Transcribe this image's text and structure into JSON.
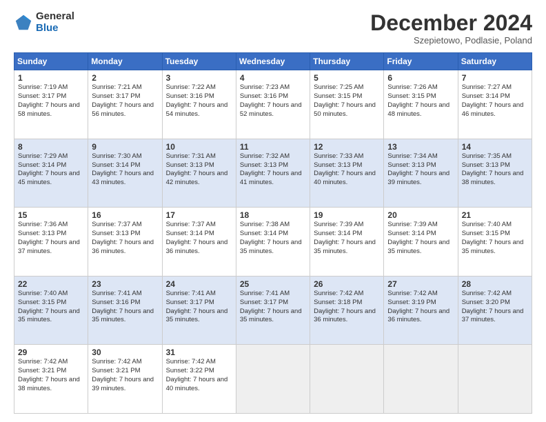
{
  "logo": {
    "general": "General",
    "blue": "Blue"
  },
  "title": "December 2024",
  "subtitle": "Szepietowo, Podlasie, Poland",
  "days_of_week": [
    "Sunday",
    "Monday",
    "Tuesday",
    "Wednesday",
    "Thursday",
    "Friday",
    "Saturday"
  ],
  "weeks": [
    [
      {
        "day": "1",
        "sunrise": "Sunrise: 7:19 AM",
        "sunset": "Sunset: 3:17 PM",
        "daylight": "Daylight: 7 hours and 58 minutes."
      },
      {
        "day": "2",
        "sunrise": "Sunrise: 7:21 AM",
        "sunset": "Sunset: 3:17 PM",
        "daylight": "Daylight: 7 hours and 56 minutes."
      },
      {
        "day": "3",
        "sunrise": "Sunrise: 7:22 AM",
        "sunset": "Sunset: 3:16 PM",
        "daylight": "Daylight: 7 hours and 54 minutes."
      },
      {
        "day": "4",
        "sunrise": "Sunrise: 7:23 AM",
        "sunset": "Sunset: 3:16 PM",
        "daylight": "Daylight: 7 hours and 52 minutes."
      },
      {
        "day": "5",
        "sunrise": "Sunrise: 7:25 AM",
        "sunset": "Sunset: 3:15 PM",
        "daylight": "Daylight: 7 hours and 50 minutes."
      },
      {
        "day": "6",
        "sunrise": "Sunrise: 7:26 AM",
        "sunset": "Sunset: 3:15 PM",
        "daylight": "Daylight: 7 hours and 48 minutes."
      },
      {
        "day": "7",
        "sunrise": "Sunrise: 7:27 AM",
        "sunset": "Sunset: 3:14 PM",
        "daylight": "Daylight: 7 hours and 46 minutes."
      }
    ],
    [
      {
        "day": "8",
        "sunrise": "Sunrise: 7:29 AM",
        "sunset": "Sunset: 3:14 PM",
        "daylight": "Daylight: 7 hours and 45 minutes."
      },
      {
        "day": "9",
        "sunrise": "Sunrise: 7:30 AM",
        "sunset": "Sunset: 3:14 PM",
        "daylight": "Daylight: 7 hours and 43 minutes."
      },
      {
        "day": "10",
        "sunrise": "Sunrise: 7:31 AM",
        "sunset": "Sunset: 3:13 PM",
        "daylight": "Daylight: 7 hours and 42 minutes."
      },
      {
        "day": "11",
        "sunrise": "Sunrise: 7:32 AM",
        "sunset": "Sunset: 3:13 PM",
        "daylight": "Daylight: 7 hours and 41 minutes."
      },
      {
        "day": "12",
        "sunrise": "Sunrise: 7:33 AM",
        "sunset": "Sunset: 3:13 PM",
        "daylight": "Daylight: 7 hours and 40 minutes."
      },
      {
        "day": "13",
        "sunrise": "Sunrise: 7:34 AM",
        "sunset": "Sunset: 3:13 PM",
        "daylight": "Daylight: 7 hours and 39 minutes."
      },
      {
        "day": "14",
        "sunrise": "Sunrise: 7:35 AM",
        "sunset": "Sunset: 3:13 PM",
        "daylight": "Daylight: 7 hours and 38 minutes."
      }
    ],
    [
      {
        "day": "15",
        "sunrise": "Sunrise: 7:36 AM",
        "sunset": "Sunset: 3:13 PM",
        "daylight": "Daylight: 7 hours and 37 minutes."
      },
      {
        "day": "16",
        "sunrise": "Sunrise: 7:37 AM",
        "sunset": "Sunset: 3:13 PM",
        "daylight": "Daylight: 7 hours and 36 minutes."
      },
      {
        "day": "17",
        "sunrise": "Sunrise: 7:37 AM",
        "sunset": "Sunset: 3:14 PM",
        "daylight": "Daylight: 7 hours and 36 minutes."
      },
      {
        "day": "18",
        "sunrise": "Sunrise: 7:38 AM",
        "sunset": "Sunset: 3:14 PM",
        "daylight": "Daylight: 7 hours and 35 minutes."
      },
      {
        "day": "19",
        "sunrise": "Sunrise: 7:39 AM",
        "sunset": "Sunset: 3:14 PM",
        "daylight": "Daylight: 7 hours and 35 minutes."
      },
      {
        "day": "20",
        "sunrise": "Sunrise: 7:39 AM",
        "sunset": "Sunset: 3:14 PM",
        "daylight": "Daylight: 7 hours and 35 minutes."
      },
      {
        "day": "21",
        "sunrise": "Sunrise: 7:40 AM",
        "sunset": "Sunset: 3:15 PM",
        "daylight": "Daylight: 7 hours and 35 minutes."
      }
    ],
    [
      {
        "day": "22",
        "sunrise": "Sunrise: 7:40 AM",
        "sunset": "Sunset: 3:15 PM",
        "daylight": "Daylight: 7 hours and 35 minutes."
      },
      {
        "day": "23",
        "sunrise": "Sunrise: 7:41 AM",
        "sunset": "Sunset: 3:16 PM",
        "daylight": "Daylight: 7 hours and 35 minutes."
      },
      {
        "day": "24",
        "sunrise": "Sunrise: 7:41 AM",
        "sunset": "Sunset: 3:17 PM",
        "daylight": "Daylight: 7 hours and 35 minutes."
      },
      {
        "day": "25",
        "sunrise": "Sunrise: 7:41 AM",
        "sunset": "Sunset: 3:17 PM",
        "daylight": "Daylight: 7 hours and 35 minutes."
      },
      {
        "day": "26",
        "sunrise": "Sunrise: 7:42 AM",
        "sunset": "Sunset: 3:18 PM",
        "daylight": "Daylight: 7 hours and 36 minutes."
      },
      {
        "day": "27",
        "sunrise": "Sunrise: 7:42 AM",
        "sunset": "Sunset: 3:19 PM",
        "daylight": "Daylight: 7 hours and 36 minutes."
      },
      {
        "day": "28",
        "sunrise": "Sunrise: 7:42 AM",
        "sunset": "Sunset: 3:20 PM",
        "daylight": "Daylight: 7 hours and 37 minutes."
      }
    ],
    [
      {
        "day": "29",
        "sunrise": "Sunrise: 7:42 AM",
        "sunset": "Sunset: 3:21 PM",
        "daylight": "Daylight: 7 hours and 38 minutes."
      },
      {
        "day": "30",
        "sunrise": "Sunrise: 7:42 AM",
        "sunset": "Sunset: 3:21 PM",
        "daylight": "Daylight: 7 hours and 39 minutes."
      },
      {
        "day": "31",
        "sunrise": "Sunrise: 7:42 AM",
        "sunset": "Sunset: 3:22 PM",
        "daylight": "Daylight: 7 hours and 40 minutes."
      },
      null,
      null,
      null,
      null
    ]
  ]
}
